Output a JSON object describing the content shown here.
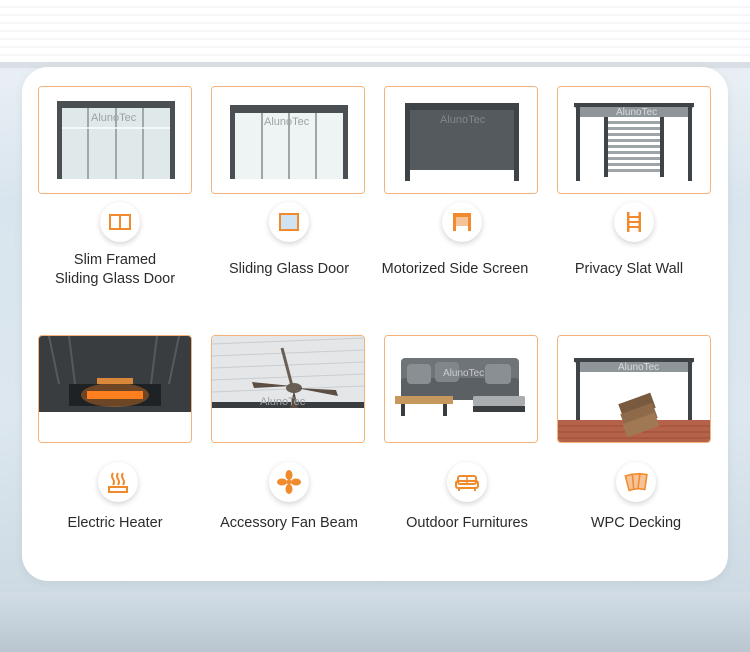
{
  "brand_watermark": "AlunoTec",
  "accent_color": "#f08a2c",
  "border_color": "#f3b27a",
  "items": [
    {
      "line1": "Slim Framed",
      "line2": "Sliding Glass Door",
      "icon": "slim-frame-icon"
    },
    {
      "line1": "Sliding Glass Door",
      "line2": "",
      "icon": "glass-door-icon"
    },
    {
      "line1": "Motorized Side Screen",
      "line2": "",
      "icon": "side-screen-icon"
    },
    {
      "line1": "Privacy Slat Wall",
      "line2": "",
      "icon": "slat-wall-icon"
    },
    {
      "line1": "Electric Heater",
      "line2": "",
      "icon": "heater-icon"
    },
    {
      "line1": "Accessory Fan Beam",
      "line2": "",
      "icon": "fan-icon"
    },
    {
      "line1": "Outdoor Furnitures",
      "line2": "",
      "icon": "sofa-icon"
    },
    {
      "line1": "WPC Decking",
      "line2": "",
      "icon": "decking-icon"
    }
  ]
}
